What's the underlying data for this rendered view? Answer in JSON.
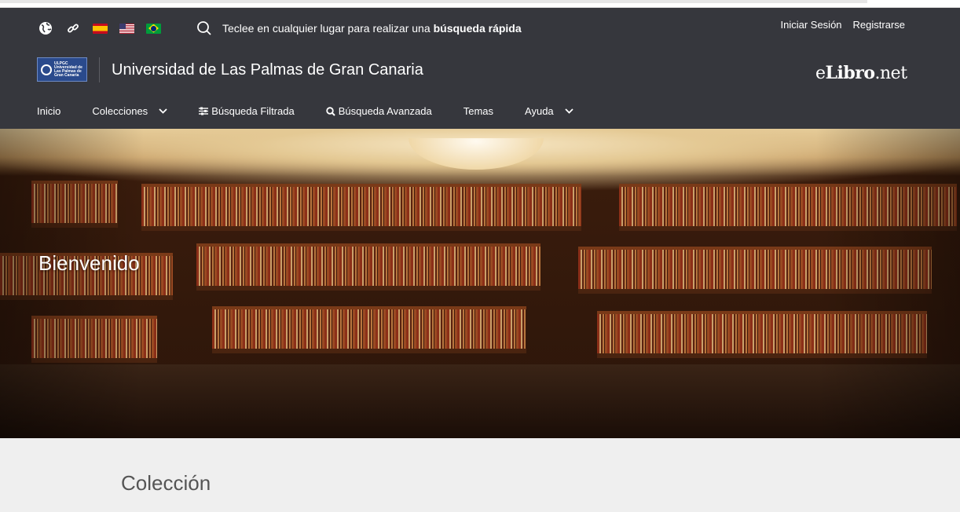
{
  "colors": {
    "header_bg": "#36373d",
    "page_bg": "#efefef",
    "heading_text": "#555555"
  },
  "top_icons": [
    {
      "name": "globe-icon"
    },
    {
      "name": "link-icon"
    },
    {
      "name": "flag-spain-icon"
    },
    {
      "name": "flag-usa-icon"
    },
    {
      "name": "flag-brazil-icon"
    }
  ],
  "search": {
    "icon": "search-icon",
    "text": "Teclee en cualquier lugar para realizar una",
    "bold": "búsqueda rápida"
  },
  "auth": {
    "login": "Iniciar Sesión",
    "register": "Registrarse"
  },
  "brand": {
    "logo_text": [
      "ULPGC",
      "Universidad de",
      "Las Palmas de",
      "Gran Canaria"
    ],
    "university_name": "Universidad de Las Palmas de Gran Canaria",
    "elibro_prefix": "e",
    "elibro_bold": "Libro",
    "elibro_suffix": ".net"
  },
  "nav": {
    "inicio": "Inicio",
    "colecciones": "Colecciones",
    "busqueda_filtrada": "Búsqueda Filtrada",
    "busqueda_avanzada": "Búsqueda Avanzada",
    "temas": "Temas",
    "ayuda": "Ayuda"
  },
  "hero": {
    "welcome": "Bienvenido"
  },
  "main": {
    "section_title": "Colección"
  }
}
